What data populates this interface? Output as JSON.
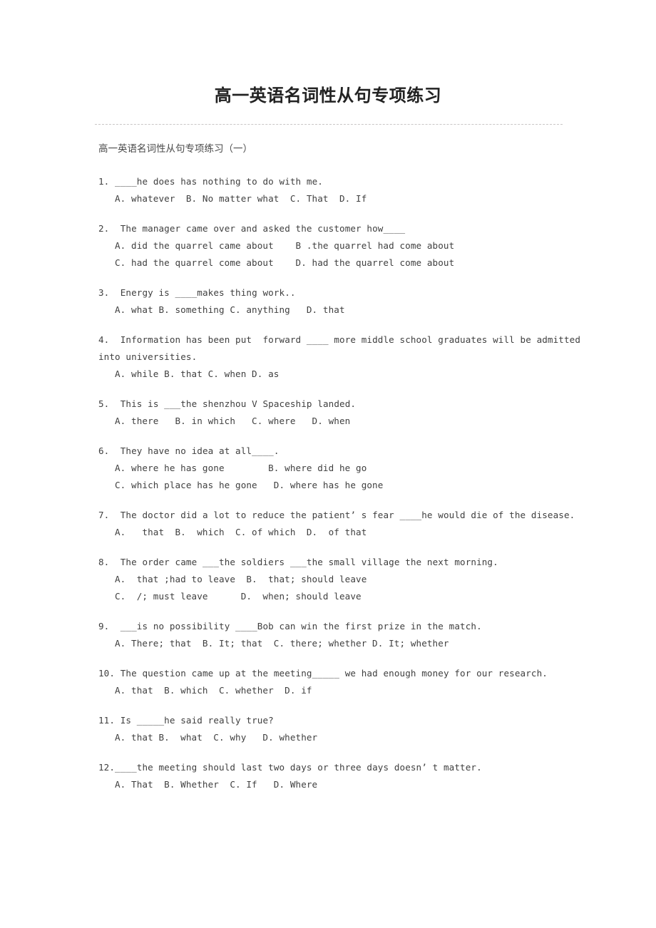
{
  "document": {
    "title": "高一英语名词性从句专项练习",
    "subtitle": "高一英语名词性从句专项练习（一）"
  },
  "questions": [
    {
      "stem": "1. ____he does has nothing to do with me.",
      "options": [
        "A. whatever  B. No matter what  C. That  D. If"
      ]
    },
    {
      "stem": "2.  The manager came over and asked the customer how____",
      "options": [
        "A. did the quarrel came about    B .the quarrel had come about",
        "C. had the quarrel come about    D. had the quarrel come about"
      ]
    },
    {
      "stem": "3.  Energy is ____makes thing work..",
      "options": [
        "A. what B. something C. anything   D. that"
      ]
    },
    {
      "stem": "4.  Information has been put  forward ____ more middle school graduates will be admitted into universities.",
      "options": [
        "A. while B. that C. when D. as"
      ]
    },
    {
      "stem": "5.  This is ___the shenzhou V Spaceship landed.",
      "options": [
        "A. there   B. in which   C. where   D. when"
      ]
    },
    {
      "stem": "6.  They have no idea at all____.",
      "options": [
        "A. where he has gone        B. where did he go",
        "C. which place has he gone   D. where has he gone"
      ]
    },
    {
      "stem": "7.  The doctor did a lot to reduce the patient’ s fear ____he would die of the disease.",
      "options": [
        "A.   that  B.  which  C. of which  D.  of that"
      ]
    },
    {
      "stem": "8.  The order came ___the soldiers ___the small village the next morning.",
      "options": [
        "A.  that ;had to leave  B.  that; should leave",
        "C.  /; must leave      D.  when; should leave"
      ]
    },
    {
      "stem": "9.  ___is no possibility ____Bob can win the first prize in the match.",
      "options": [
        "A. There; that  B. It; that  C. there; whether D. It; whether"
      ]
    },
    {
      "stem": "10. The question came up at the meeting_____ we had enough money for our research.",
      "options": [
        "A. that  B. which  C. whether  D. if"
      ]
    },
    {
      "stem": "11. Is _____he said really true?",
      "options": [
        "A. that B.  what  C. why   D. whether"
      ]
    },
    {
      "stem": "12.____the meeting should last two days or three days doesn’ t matter.",
      "options": [
        "A. That  B. Whether  C. If   D. Where"
      ]
    }
  ]
}
